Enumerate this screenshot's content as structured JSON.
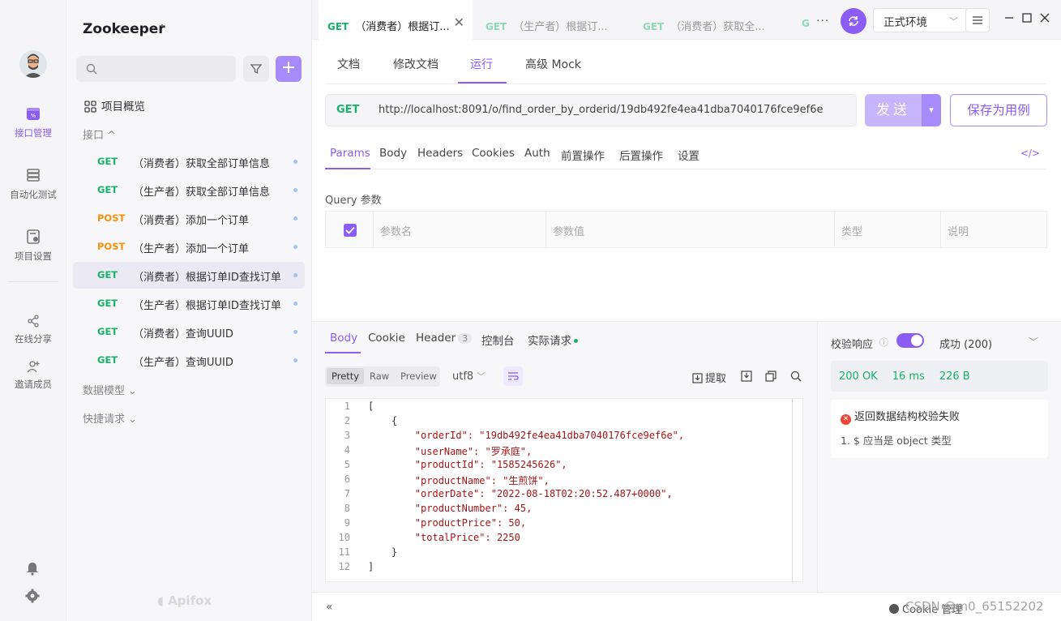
{
  "rail": {
    "items": [
      {
        "label": "接口管理"
      },
      {
        "label": "自动化测试"
      },
      {
        "label": "项目设置"
      },
      {
        "label": "在线分享"
      },
      {
        "label": "邀请成员"
      }
    ]
  },
  "sidebar": {
    "project_name": "Zookeeper",
    "overview": "项目概览",
    "group_api": "接口 ^",
    "group_models": "数据模型 ⌄",
    "group_quick": "快捷请求 ⌄",
    "apis": [
      {
        "method": "GET",
        "name": "（消费者）获取全部订单信息"
      },
      {
        "method": "GET",
        "name": "（生产者）获取全部订单信息"
      },
      {
        "method": "POST",
        "name": "（消费者）添加一个订单"
      },
      {
        "method": "POST",
        "name": "（生产者）添加一个订单"
      },
      {
        "method": "GET",
        "name": "（消费者）根据订单ID查找订单"
      },
      {
        "method": "GET",
        "name": "（生产者）根据订单ID查找订单"
      },
      {
        "method": "GET",
        "name": "（消费者）查询UUID"
      },
      {
        "method": "GET",
        "name": "（生产者）查询UUID"
      }
    ],
    "brand": "Apifox"
  },
  "tabs": [
    {
      "method": "GET",
      "title": "（消费者）根据订..."
    },
    {
      "method": "GET",
      "title": "（生产者）根据订..."
    },
    {
      "method": "GET",
      "title": "（消费者）获取全..."
    },
    {
      "method": "G",
      "title": ""
    }
  ],
  "env": "正式环境",
  "subtabs": [
    "文档",
    "修改文档",
    "运行",
    "高级 Mock"
  ],
  "request": {
    "method": "GET",
    "url": "http://localhost:8091/o/find_order_by_orderid/19db492fe4ea41dba7040176fce9ef6e",
    "send_label": "发送",
    "save_label": "保存为用例"
  },
  "req_tabs": [
    "Params",
    "Body",
    "Headers",
    "Cookies",
    "Auth",
    "前置操作",
    "后置操作",
    "设置"
  ],
  "code_toggle": "</>",
  "query": {
    "label": "Query 参数",
    "columns": [
      "参数名",
      "参数值",
      "类型",
      "说明"
    ]
  },
  "response": {
    "tabs": [
      "Body",
      "Cookie",
      "Header",
      "控制台",
      "实际请求"
    ],
    "header_count": "3",
    "formats": [
      "Pretty",
      "Raw",
      "Preview"
    ],
    "encoding": "utf8",
    "extract_label": "提取",
    "lines": [
      "[",
      "    {",
      "        \"orderId\": \"19db492fe4ea41dba7040176fce9ef6e\",",
      "        \"userName\": \"罗承庭\",",
      "        \"productId\": \"1585245626\",",
      "        \"productName\": \"生煎饼\",",
      "        \"orderDate\": \"2022-08-18T02:20:52.487+0000\",",
      "        \"productNumber\": 45,",
      "        \"productPrice\": 50,",
      "        \"totalPrice\": 2250",
      "    }",
      "]"
    ]
  },
  "validation": {
    "label": "校验响应",
    "status_select": "成功 (200)",
    "status": "200 OK",
    "time": "16 ms",
    "size": "226 B",
    "error_title": "返回数据结构校验失败",
    "error_detail": "1. $ 应当是 object 类型"
  },
  "statusbar": {
    "right_text": "Cookie 管理",
    "watermark": "CSDN @m0_65152202"
  },
  "colors": {
    "accent": "#8b5cf6",
    "get": "#17b26a",
    "post": "#f79009"
  }
}
